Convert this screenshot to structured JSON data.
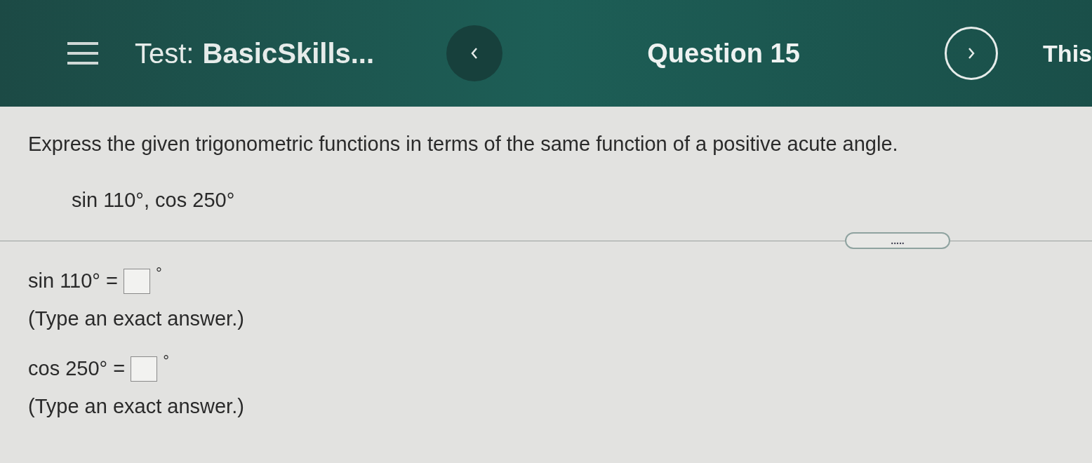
{
  "header": {
    "test_label": "Test:",
    "test_name": "BasicSkills...",
    "question": "Question 15",
    "next_label": "This"
  },
  "instruction": "Express the given trigonometric functions in terms of the same function of a positive acute angle.",
  "expression": "sin 110°, cos 250°",
  "more_button": ".....",
  "answers": [
    {
      "prefix": "sin 110° =",
      "suffix": "°",
      "hint": "(Type an exact answer.)"
    },
    {
      "prefix": "cos 250° =",
      "suffix": "°",
      "hint": "(Type an exact answer.)"
    }
  ]
}
